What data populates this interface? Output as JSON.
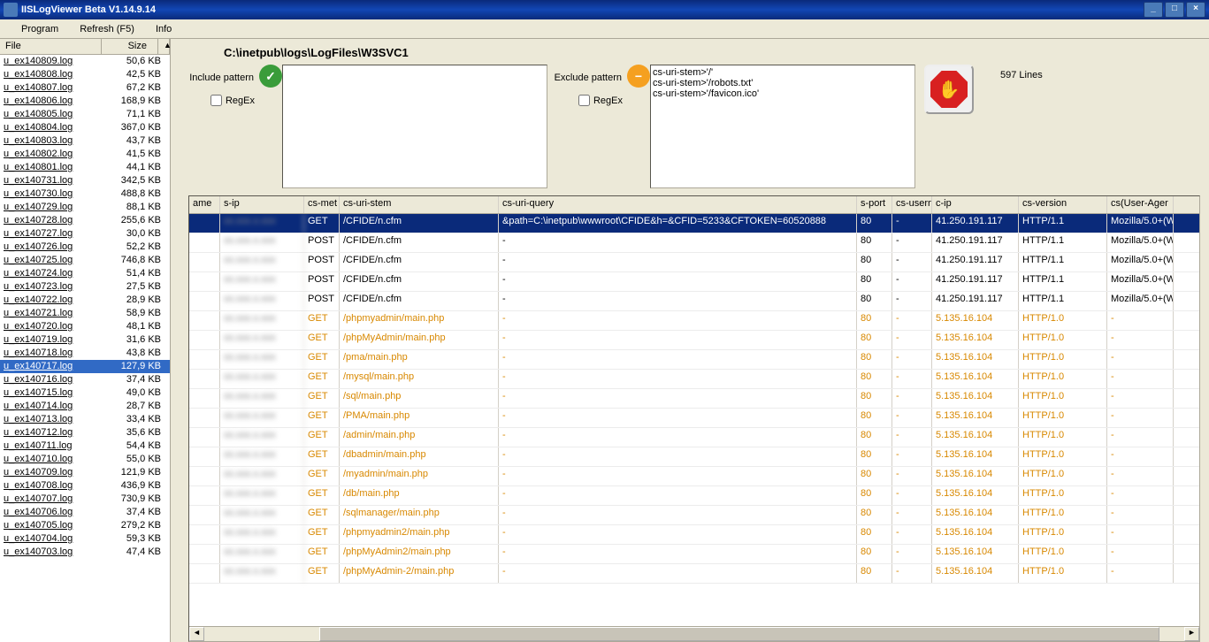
{
  "title": "IISLogViewer Beta V1.14.9.14",
  "menu": {
    "program": "Program",
    "refresh": "Refresh (F5)",
    "info": "Info"
  },
  "filehdr": {
    "file": "File",
    "size": "Size"
  },
  "files": [
    {
      "n": "u_ex140809.log",
      "s": "50,6 KB"
    },
    {
      "n": "u_ex140808.log",
      "s": "42,5 KB"
    },
    {
      "n": "u_ex140807.log",
      "s": "67,2 KB"
    },
    {
      "n": "u_ex140806.log",
      "s": "168,9 KB"
    },
    {
      "n": "u_ex140805.log",
      "s": "71,1 KB"
    },
    {
      "n": "u_ex140804.log",
      "s": "367,0 KB"
    },
    {
      "n": "u_ex140803.log",
      "s": "43,7 KB"
    },
    {
      "n": "u_ex140802.log",
      "s": "41,5 KB"
    },
    {
      "n": "u_ex140801.log",
      "s": "44,1 KB"
    },
    {
      "n": "u_ex140731.log",
      "s": "342,5 KB"
    },
    {
      "n": "u_ex140730.log",
      "s": "488,8 KB"
    },
    {
      "n": "u_ex140729.log",
      "s": "88,1 KB"
    },
    {
      "n": "u_ex140728.log",
      "s": "255,6 KB"
    },
    {
      "n": "u_ex140727.log",
      "s": "30,0 KB"
    },
    {
      "n": "u_ex140726.log",
      "s": "52,2 KB"
    },
    {
      "n": "u_ex140725.log",
      "s": "746,8 KB"
    },
    {
      "n": "u_ex140724.log",
      "s": "51,4 KB"
    },
    {
      "n": "u_ex140723.log",
      "s": "27,5 KB"
    },
    {
      "n": "u_ex140722.log",
      "s": "28,9 KB"
    },
    {
      "n": "u_ex140721.log",
      "s": "58,9 KB"
    },
    {
      "n": "u_ex140720.log",
      "s": "48,1 KB"
    },
    {
      "n": "u_ex140719.log",
      "s": "31,6 KB"
    },
    {
      "n": "u_ex140718.log",
      "s": "43,8 KB"
    },
    {
      "n": "u_ex140717.log",
      "s": "127,9 KB",
      "sel": true
    },
    {
      "n": "u_ex140716.log",
      "s": "37,4 KB"
    },
    {
      "n": "u_ex140715.log",
      "s": "49,0 KB"
    },
    {
      "n": "u_ex140714.log",
      "s": "28,7 KB"
    },
    {
      "n": "u_ex140713.log",
      "s": "33,4 KB"
    },
    {
      "n": "u_ex140712.log",
      "s": "35,6 KB"
    },
    {
      "n": "u_ex140711.log",
      "s": "54,4 KB"
    },
    {
      "n": "u_ex140710.log",
      "s": "55,0 KB"
    },
    {
      "n": "u_ex140709.log",
      "s": "121,9 KB"
    },
    {
      "n": "u_ex140708.log",
      "s": "436,9 KB"
    },
    {
      "n": "u_ex140707.log",
      "s": "730,9 KB"
    },
    {
      "n": "u_ex140706.log",
      "s": "37,4 KB"
    },
    {
      "n": "u_ex140705.log",
      "s": "279,2 KB"
    },
    {
      "n": "u_ex140704.log",
      "s": "59,3 KB"
    },
    {
      "n": "u_ex140703.log",
      "s": "47,4 KB"
    }
  ],
  "path": "C:\\inetpub\\logs\\LogFiles\\W3SVC1",
  "include": {
    "label": "Include pattern",
    "regex": "RegEx",
    "value": ""
  },
  "exclude": {
    "label": "Exclude pattern",
    "regex": "RegEx",
    "value": "cs-uri-stem>'/'\ncs-uri-stem>'/robots.txt'\ncs-uri-stem>'/favicon.ico'"
  },
  "linecount": "597 Lines",
  "gridhdr": {
    "name": "ame",
    "sip": "s-ip",
    "met": "cs-met",
    "stem": "cs-uri-stem",
    "qry": "cs-uri-query",
    "port": "s-port",
    "user": "cs-usern",
    "cip": "c-ip",
    "ver": "cs-version",
    "ua": "cs(User-Ager"
  },
  "rows": [
    {
      "met": "GET",
      "stem": "/CFIDE/n.cfm",
      "qry": "&path=C:\\inetpub\\wwwroot\\CFIDE&h=&CFID=5233&CFTOKEN=60520888",
      "port": "80",
      "user": "-",
      "cip": "41.250.191.117",
      "ver": "HTTP/1.1",
      "ua": "Mozilla/5.0+(W",
      "sel": true
    },
    {
      "met": "POST",
      "stem": "/CFIDE/n.cfm",
      "qry": "-",
      "port": "80",
      "user": "-",
      "cip": "41.250.191.117",
      "ver": "HTTP/1.1",
      "ua": "Mozilla/5.0+(W"
    },
    {
      "met": "POST",
      "stem": "/CFIDE/n.cfm",
      "qry": "-",
      "port": "80",
      "user": "-",
      "cip": "41.250.191.117",
      "ver": "HTTP/1.1",
      "ua": "Mozilla/5.0+(W"
    },
    {
      "met": "POST",
      "stem": "/CFIDE/n.cfm",
      "qry": "-",
      "port": "80",
      "user": "-",
      "cip": "41.250.191.117",
      "ver": "HTTP/1.1",
      "ua": "Mozilla/5.0+(W"
    },
    {
      "met": "POST",
      "stem": "/CFIDE/n.cfm",
      "qry": "-",
      "port": "80",
      "user": "-",
      "cip": "41.250.191.117",
      "ver": "HTTP/1.1",
      "ua": "Mozilla/5.0+(W"
    },
    {
      "met": "GET",
      "stem": "/phpmyadmin/main.php",
      "qry": "-",
      "port": "80",
      "user": "-",
      "cip": "5.135.16.104",
      "ver": "HTTP/1.0",
      "ua": "-",
      "hot": true
    },
    {
      "met": "GET",
      "stem": "/phpMyAdmin/main.php",
      "qry": "-",
      "port": "80",
      "user": "-",
      "cip": "5.135.16.104",
      "ver": "HTTP/1.0",
      "ua": "-",
      "hot": true
    },
    {
      "met": "GET",
      "stem": "/pma/main.php",
      "qry": "-",
      "port": "80",
      "user": "-",
      "cip": "5.135.16.104",
      "ver": "HTTP/1.0",
      "ua": "-",
      "hot": true
    },
    {
      "met": "GET",
      "stem": "/mysql/main.php",
      "qry": "-",
      "port": "80",
      "user": "-",
      "cip": "5.135.16.104",
      "ver": "HTTP/1.0",
      "ua": "-",
      "hot": true
    },
    {
      "met": "GET",
      "stem": "/sql/main.php",
      "qry": "-",
      "port": "80",
      "user": "-",
      "cip": "5.135.16.104",
      "ver": "HTTP/1.0",
      "ua": "-",
      "hot": true
    },
    {
      "met": "GET",
      "stem": "/PMA/main.php",
      "qry": "-",
      "port": "80",
      "user": "-",
      "cip": "5.135.16.104",
      "ver": "HTTP/1.0",
      "ua": "-",
      "hot": true
    },
    {
      "met": "GET",
      "stem": "/admin/main.php",
      "qry": "-",
      "port": "80",
      "user": "-",
      "cip": "5.135.16.104",
      "ver": "HTTP/1.0",
      "ua": "-",
      "hot": true
    },
    {
      "met": "GET",
      "stem": "/dbadmin/main.php",
      "qry": "-",
      "port": "80",
      "user": "-",
      "cip": "5.135.16.104",
      "ver": "HTTP/1.0",
      "ua": "-",
      "hot": true
    },
    {
      "met": "GET",
      "stem": "/myadmin/main.php",
      "qry": "-",
      "port": "80",
      "user": "-",
      "cip": "5.135.16.104",
      "ver": "HTTP/1.0",
      "ua": "-",
      "hot": true
    },
    {
      "met": "GET",
      "stem": "/db/main.php",
      "qry": "-",
      "port": "80",
      "user": "-",
      "cip": "5.135.16.104",
      "ver": "HTTP/1.0",
      "ua": "-",
      "hot": true
    },
    {
      "met": "GET",
      "stem": "/sqlmanager/main.php",
      "qry": "-",
      "port": "80",
      "user": "-",
      "cip": "5.135.16.104",
      "ver": "HTTP/1.0",
      "ua": "-",
      "hot": true
    },
    {
      "met": "GET",
      "stem": "/phpmyadmin2/main.php",
      "qry": "-",
      "port": "80",
      "user": "-",
      "cip": "5.135.16.104",
      "ver": "HTTP/1.0",
      "ua": "-",
      "hot": true
    },
    {
      "met": "GET",
      "stem": "/phpMyAdmin2/main.php",
      "qry": "-",
      "port": "80",
      "user": "-",
      "cip": "5.135.16.104",
      "ver": "HTTP/1.0",
      "ua": "-",
      "hot": true
    },
    {
      "met": "GET",
      "stem": "/phpMyAdmin-2/main.php",
      "qry": "-",
      "port": "80",
      "user": "-",
      "cip": "5.135.16.104",
      "ver": "HTTP/1.0",
      "ua": "-",
      "hot": true
    }
  ]
}
